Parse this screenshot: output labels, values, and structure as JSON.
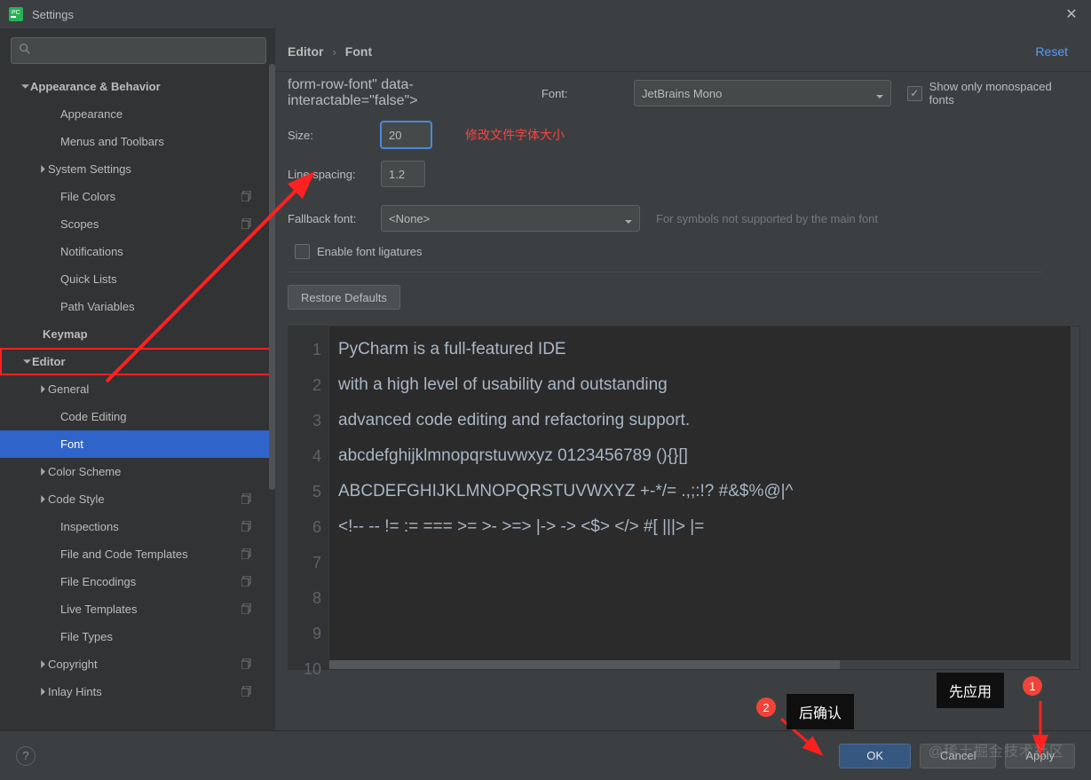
{
  "title": "Settings",
  "breadcrumb": {
    "parent": "Editor",
    "current": "Font"
  },
  "reset_label": "Reset",
  "sidebar": {
    "items": [
      {
        "label": "Appearance & Behavior",
        "indent": 22,
        "bold": true,
        "arrow": "down",
        "copy": false
      },
      {
        "label": "Appearance",
        "indent": 56,
        "bold": false,
        "arrow": "",
        "copy": false
      },
      {
        "label": "Menus and Toolbars",
        "indent": 56,
        "bold": false,
        "arrow": "",
        "copy": false
      },
      {
        "label": "System Settings",
        "indent": 42,
        "bold": false,
        "arrow": "right",
        "copy": false
      },
      {
        "label": "File Colors",
        "indent": 56,
        "bold": false,
        "arrow": "",
        "copy": true
      },
      {
        "label": "Scopes",
        "indent": 56,
        "bold": false,
        "arrow": "",
        "copy": true
      },
      {
        "label": "Notifications",
        "indent": 56,
        "bold": false,
        "arrow": "",
        "copy": false
      },
      {
        "label": "Quick Lists",
        "indent": 56,
        "bold": false,
        "arrow": "",
        "copy": false
      },
      {
        "label": "Path Variables",
        "indent": 56,
        "bold": false,
        "arrow": "",
        "copy": false
      },
      {
        "label": "Keymap",
        "indent": 36,
        "bold": true,
        "arrow": "",
        "copy": false
      },
      {
        "label": "Editor",
        "indent": 22,
        "bold": true,
        "arrow": "down",
        "copy": false,
        "redbox": true
      },
      {
        "label": "General",
        "indent": 42,
        "bold": false,
        "arrow": "right",
        "copy": false
      },
      {
        "label": "Code Editing",
        "indent": 56,
        "bold": false,
        "arrow": "",
        "copy": false
      },
      {
        "label": "Font",
        "indent": 56,
        "bold": false,
        "arrow": "",
        "copy": false,
        "selected": true
      },
      {
        "label": "Color Scheme",
        "indent": 42,
        "bold": false,
        "arrow": "right",
        "copy": false
      },
      {
        "label": "Code Style",
        "indent": 42,
        "bold": false,
        "arrow": "right",
        "copy": true
      },
      {
        "label": "Inspections",
        "indent": 56,
        "bold": false,
        "arrow": "",
        "copy": true
      },
      {
        "label": "File and Code Templates",
        "indent": 56,
        "bold": false,
        "arrow": "",
        "copy": true
      },
      {
        "label": "File Encodings",
        "indent": 56,
        "bold": false,
        "arrow": "",
        "copy": true
      },
      {
        "label": "Live Templates",
        "indent": 56,
        "bold": false,
        "arrow": "",
        "copy": true
      },
      {
        "label": "File Types",
        "indent": 56,
        "bold": false,
        "arrow": "",
        "copy": false
      },
      {
        "label": "Copyright",
        "indent": 42,
        "bold": false,
        "arrow": "right",
        "copy": true
      },
      {
        "label": "Inlay Hints",
        "indent": 42,
        "bold": false,
        "arrow": "right",
        "copy": true
      }
    ]
  },
  "form": {
    "font_label": "Font:",
    "font_value": "JetBrains Mono",
    "mono_label": "Show only monospaced fonts",
    "mono_checked": true,
    "size_label": "Size:",
    "size_value": "20",
    "red_note": "修改文件字体大小",
    "spacing_label": "Line spacing:",
    "spacing_value": "1.2",
    "fallback_label": "Fallback font:",
    "fallback_value": "<None>",
    "fallback_hint": "For symbols not supported by the main font",
    "ligatures_label": "Enable font ligatures",
    "ligatures_checked": false,
    "restore_label": "Restore Defaults"
  },
  "preview": {
    "lines": [
      "PyCharm is a full-featured IDE",
      "with a high level of usability and outstanding",
      "advanced code editing and refactoring support.",
      "",
      "abcdefghijklmnopqrstuvwxyz 0123456789 (){}[]",
      "ABCDEFGHIJKLMNOPQRSTUVWXYZ +-*/= .,;:!? #&$%@|^",
      "",
      "<!-- -- != := === >= >- >=> |-> -> <$> </> #[ |||> |="
    ],
    "line_numbers": [
      "1",
      "2",
      "3",
      "4",
      "5",
      "6",
      "7",
      "8",
      "9",
      "10"
    ]
  },
  "footer": {
    "ok": "OK",
    "cancel": "Cancel",
    "apply": "Apply"
  },
  "annotations": {
    "tooltip_apply": "先应用",
    "tooltip_ok": "后确认",
    "badge1": "1",
    "badge2": "2",
    "watermark": "@稀土掘金技术社区"
  }
}
